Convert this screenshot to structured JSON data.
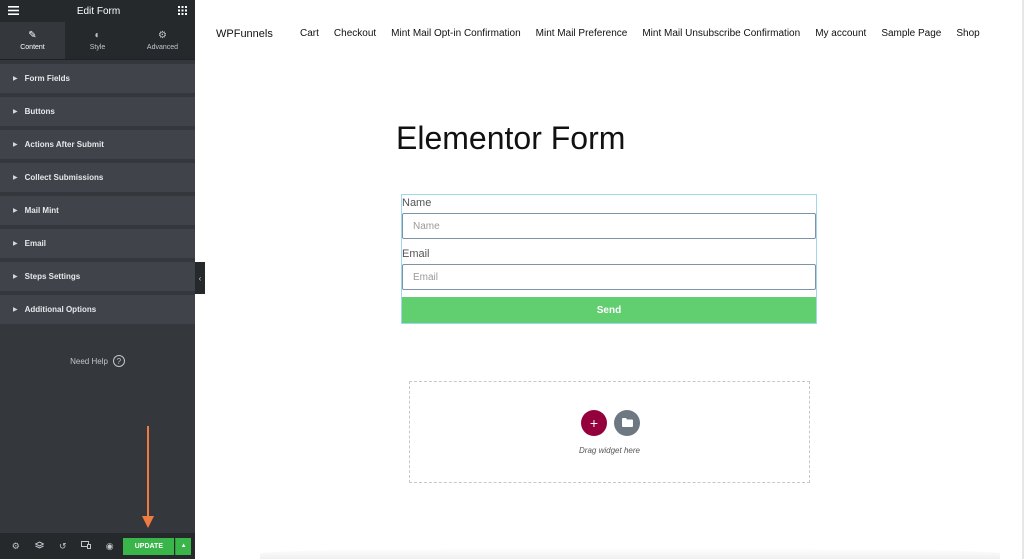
{
  "panel": {
    "title": "Edit Form",
    "menu_icon": "hamburger-icon",
    "widgets_icon": "grid-icon",
    "tabs": [
      {
        "label": "Content",
        "icon": "pencil-icon"
      },
      {
        "label": "Style",
        "icon": "half-circle-icon"
      },
      {
        "label": "Advanced",
        "icon": "gear-icon"
      }
    ],
    "sections": [
      "Form Fields",
      "Buttons",
      "Actions After Submit",
      "Collect Submissions",
      "Mail Mint",
      "Email",
      "Steps Settings",
      "Additional Options"
    ],
    "need_help": "Need Help",
    "footer": {
      "update_label": "UPDATE"
    }
  },
  "site": {
    "title": "WPFunnels",
    "nav": [
      "Cart",
      "Checkout",
      "Mint Mail Opt-in Confirmation",
      "Mint Mail Preference",
      "Mint Mail Unsubscribe Confirmation",
      "My account",
      "Sample Page",
      "Shop"
    ]
  },
  "page": {
    "heading": "Elementor Form",
    "form": {
      "name_label": "Name",
      "name_placeholder": "Name",
      "email_label": "Email",
      "email_placeholder": "Email",
      "send_label": "Send"
    },
    "drop_zone": {
      "text": "Drag widget here"
    }
  },
  "colors": {
    "panel_bg": "#34383c",
    "update_green": "#39b54a",
    "send_green": "#61ce70",
    "add_button": "#93003c",
    "annotation_arrow": "#f07b3f"
  }
}
